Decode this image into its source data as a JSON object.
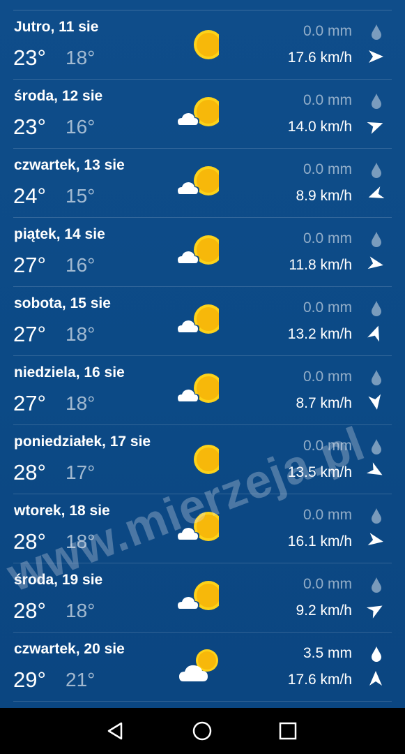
{
  "colors": {
    "sun": "#f7b80a",
    "sun_ring": "#fdd21a",
    "cloud": "#ffffff"
  },
  "forecast": [
    {
      "date": "Jutro, 11 sie",
      "tmax": "23°",
      "tmin": "18°",
      "icon": "sun-icon",
      "rain": "0.0 mm",
      "rain_active": false,
      "wind": "17.6 km/h",
      "wind_dir_deg": 90
    },
    {
      "date": "środa, 12 sie",
      "tmax": "23°",
      "tmin": "16°",
      "icon": "sun-cloud-icon",
      "rain": "0.0 mm",
      "rain_active": false,
      "wind": "14.0 km/h",
      "wind_dir_deg": 70
    },
    {
      "date": "czwartek, 13 sie",
      "tmax": "24°",
      "tmin": "15°",
      "icon": "sun-cloud-icon",
      "rain": "0.0 mm",
      "rain_active": false,
      "wind": "8.9 km/h",
      "wind_dir_deg": 250
    },
    {
      "date": "piątek, 14 sie",
      "tmax": "27°",
      "tmin": "16°",
      "icon": "sun-cloud-icon",
      "rain": "0.0 mm",
      "rain_active": false,
      "wind": "11.8 km/h",
      "wind_dir_deg": 100
    },
    {
      "date": "sobota, 15 sie",
      "tmax": "27°",
      "tmin": "18°",
      "icon": "sun-cloud-icon",
      "rain": "0.0 mm",
      "rain_active": false,
      "wind": "13.2 km/h",
      "wind_dir_deg": 20
    },
    {
      "date": "niedziela, 16 sie",
      "tmax": "27°",
      "tmin": "18°",
      "icon": "sun-cloud-icon",
      "rain": "0.0 mm",
      "rain_active": false,
      "wind": "8.7 km/h",
      "wind_dir_deg": 170
    },
    {
      "date": "poniedziałek, 17 sie",
      "tmax": "28°",
      "tmin": "17°",
      "icon": "sun-icon",
      "rain": "0.0 mm",
      "rain_active": false,
      "wind": "13.5 km/h",
      "wind_dir_deg": 120
    },
    {
      "date": "wtorek, 18 sie",
      "tmax": "28°",
      "tmin": "18°",
      "icon": "sun-cloud-icon",
      "rain": "0.0 mm",
      "rain_active": false,
      "wind": "16.1 km/h",
      "wind_dir_deg": 100
    },
    {
      "date": "środa, 19 sie",
      "tmax": "28°",
      "tmin": "18°",
      "icon": "sun-cloud-icon",
      "rain": "0.0 mm",
      "rain_active": false,
      "wind": "9.2 km/h",
      "wind_dir_deg": 60
    },
    {
      "date": "czwartek, 20 sie",
      "tmax": "29°",
      "tmin": "21°",
      "icon": "cloud-sun-icon",
      "rain": "3.5 mm",
      "rain_active": true,
      "wind": "17.6 km/h",
      "wind_dir_deg": 0
    }
  ],
  "watermark": "www.mierzeja.pl",
  "navbar": {
    "back": "back-icon",
    "home": "home-icon",
    "recents": "recents-icon"
  }
}
